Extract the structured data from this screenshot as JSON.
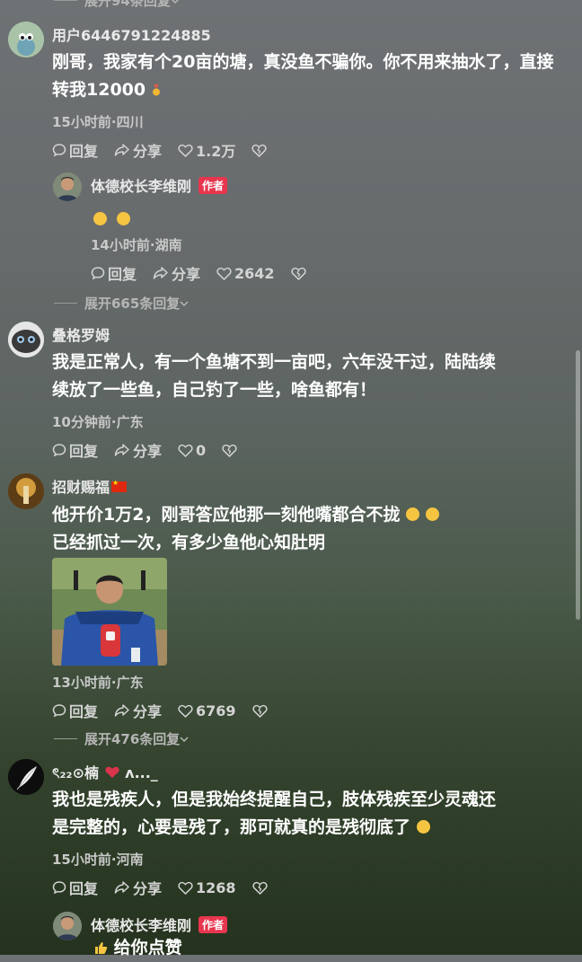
{
  "top_expand": {
    "label": "展开94条回复"
  },
  "comments": [
    {
      "username": "用户6446791224885",
      "text": "刚哥，我家有个20亩的塘，真没鱼不骗你。你不用来抽水了，直接转我12000",
      "meta": "15小时前·四川",
      "reply_label": "回复",
      "share_label": "分享",
      "likes": "1.2万",
      "reply": {
        "username": "体德校长李维刚",
        "badge": "作者",
        "meta": "14小时前·湖南",
        "reply_label": "回复",
        "share_label": "分享",
        "likes": "2642"
      },
      "expand_label": "展开665条回复"
    },
    {
      "username": "叠格罗姆",
      "text_line1": "我是正常人，有一个鱼塘不到一亩吧，六年没干过，陆陆续",
      "text_line2": "续放了一些鱼，自己钓了一些，啥鱼都有！",
      "meta": "10分钟前·广东",
      "reply_label": "回复",
      "share_label": "分享",
      "likes": "0"
    },
    {
      "username": "招财赐福",
      "text_line1": "他开价1万2，刚哥答应他那一刻他嘴都合不拢",
      "text_line2": "已经抓过一次，有多少鱼他心知肚明",
      "meta": "13小时前·广东",
      "reply_label": "回复",
      "share_label": "分享",
      "likes": "6769",
      "expand_label": "展开476条回复"
    },
    {
      "username": "ৎ₂₂⊙楠",
      "username_tail": "ʌ..._",
      "text_line1": "我也是残疾人，但是我始终提醒自己，肢体残疾至少灵魂还",
      "text_line2": "是完整的，心要是残了，那可就真的是残彻底了",
      "meta": "15小时前·河南",
      "reply_label": "回复",
      "share_label": "分享",
      "likes": "1268",
      "reply": {
        "username": "体德校长李维刚",
        "badge": "作者",
        "text": "给你点赞"
      }
    }
  ],
  "colors": {
    "author_badge": "#e8364f",
    "background_top": "#6e7274",
    "background_bottom": "#24321e"
  }
}
